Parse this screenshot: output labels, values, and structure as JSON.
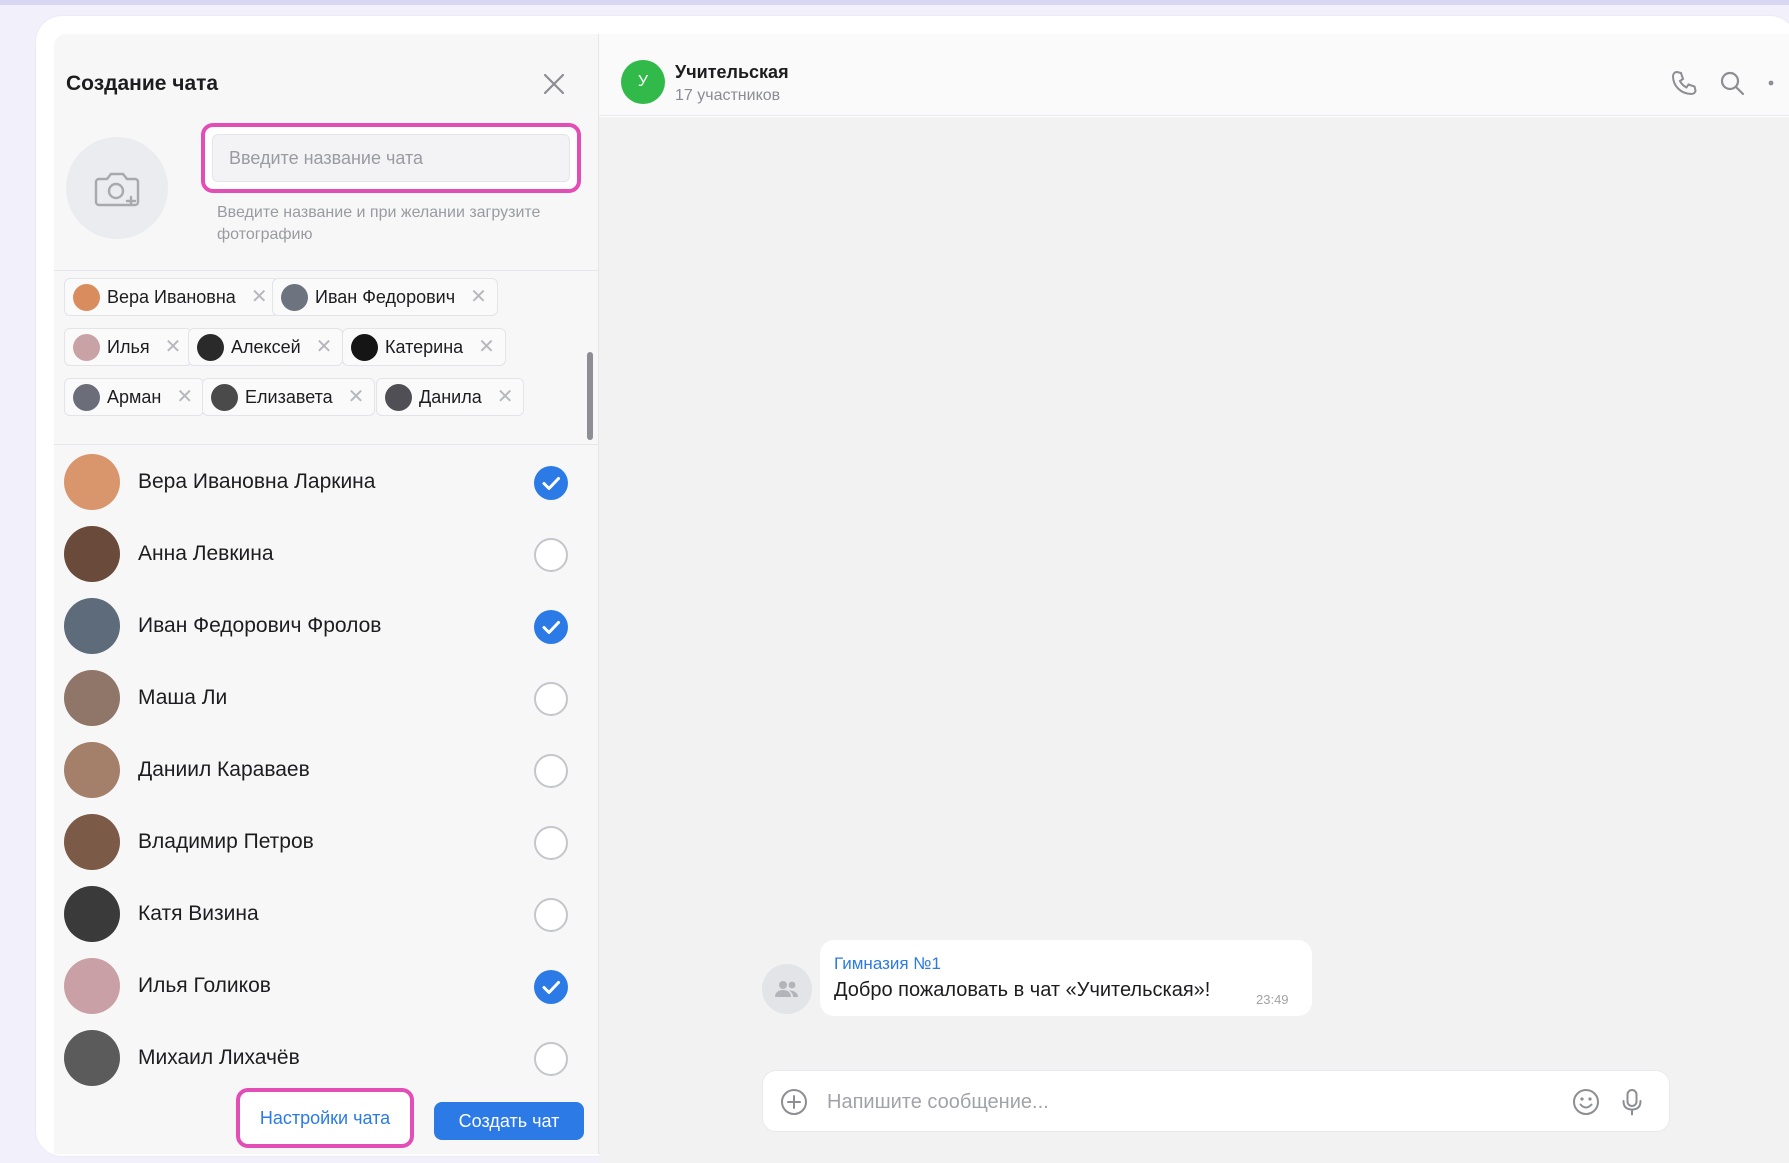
{
  "panel": {
    "title": "Создание чата",
    "name_placeholder": "Введите название чата",
    "name_value": "",
    "hint": "Введите название и при желании загрузите фотографию",
    "settings_label": "Настройки чата",
    "create_label": "Создать чат"
  },
  "chips": [
    {
      "label": "Вера Ивановна",
      "color": "#d98c5e"
    },
    {
      "label": "Иван Федорович",
      "color": "#6d7480"
    },
    {
      "label": "Илья",
      "color": "#c9a2a6"
    },
    {
      "label": "Алексей",
      "color": "#2a2a2a"
    },
    {
      "label": "Катерина",
      "color": "#151515"
    },
    {
      "label": "Арман",
      "color": "#6b6e78"
    },
    {
      "label": "Елизавета",
      "color": "#4a4a4a"
    },
    {
      "label": "Данила",
      "color": "#4f4f55"
    }
  ],
  "contacts": [
    {
      "name": "Вера Ивановна Ларкина",
      "checked": true,
      "color": "#d9956b"
    },
    {
      "name": "Анна Левкина",
      "checked": false,
      "color": "#6a4a3a"
    },
    {
      "name": "Иван Федорович Фролов",
      "checked": true,
      "color": "#5e6b7a"
    },
    {
      "name": "Маша Ли",
      "checked": false,
      "color": "#8f7668"
    },
    {
      "name": "Даниил Караваев",
      "checked": false,
      "color": "#a47f6a"
    },
    {
      "name": "Владимир Петров",
      "checked": false,
      "color": "#7b5a48"
    },
    {
      "name": "Катя Визина",
      "checked": false,
      "color": "#3a3a3a"
    },
    {
      "name": "Илья Голиков",
      "checked": true,
      "color": "#c9a0a5"
    },
    {
      "name": "Михаил Лихачёв",
      "checked": false,
      "color": "#5b5b5b"
    }
  ],
  "chat": {
    "avatar_letter": "У",
    "title": "Учительская",
    "subtitle": "17 участников",
    "message": {
      "author": "Гимназия №1",
      "text": "Добро пожаловать в чат «Учительская»!",
      "time": "23:49"
    },
    "composer_placeholder": "Напишите сообщение..."
  },
  "colors": {
    "accent": "#2b7ae5",
    "highlight": "#e24eb6",
    "chat_avatar": "#31b94a"
  },
  "icons": [
    "close-icon",
    "camera-add-icon",
    "phone-icon",
    "search-icon",
    "more-icon",
    "group-icon",
    "plus-circle-icon",
    "emoji-icon",
    "microphone-icon",
    "checkmark-icon"
  ]
}
